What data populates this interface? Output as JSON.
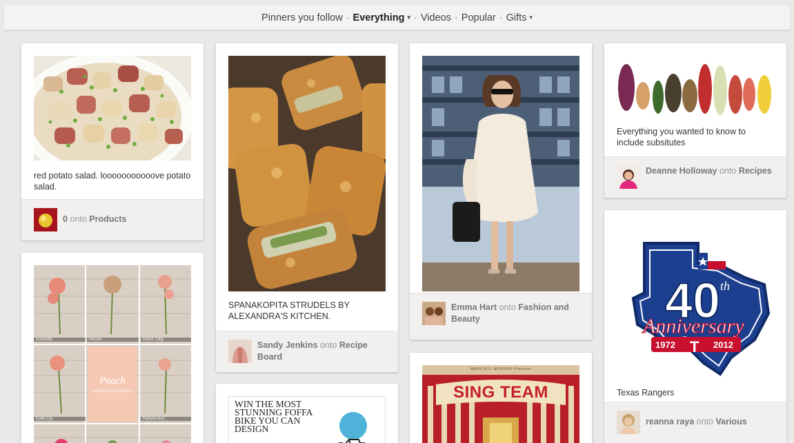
{
  "nav": {
    "items": [
      {
        "label": "Pinners you follow"
      },
      {
        "label": "Everything"
      },
      {
        "label": "Videos"
      },
      {
        "label": "Popular"
      },
      {
        "label": "Gifts"
      }
    ],
    "separator": "·",
    "caret": "▾"
  },
  "pins": {
    "potato": {
      "description": "red potato salad. looooooooooove potato salad.",
      "pinner": "0",
      "onto": "onto",
      "board": "Products"
    },
    "flowers": {
      "labels": [
        "Amaryllis",
        "Peonie",
        "Dutch Tulip",
        "Calla Lily",
        "Peach",
        "Ranunculus"
      ],
      "center_title": "Peach",
      "center_sub": "WEDDING FLOWERS"
    },
    "strudel": {
      "description": "SPANAKOPITA STRUDELS BY ALEXANDRA'S KITCHEN.",
      "pinner": "Sandy Jenkins",
      "onto": "onto",
      "board": "Recipe Board"
    },
    "win": {
      "headline": "WIN THE MOST STUNNING FOFFA BIKE YOU CAN DESIGN"
    },
    "fashion": {
      "pinner": "Emma Hart",
      "onto": "onto",
      "board": "Fashion and Beauty"
    },
    "singteam": {
      "kicker": "MARS HILL WORSHIP Presents",
      "title": "SING TEAM"
    },
    "veggies": {
      "description": "Everything you wanted to know to include subsitutes",
      "pinner": "Deanne Holloway",
      "onto": "onto",
      "board": "Recipes"
    },
    "rangers": {
      "description": "Texas Rangers",
      "pinner": "reanna raya",
      "onto": "onto",
      "board": "Various",
      "logo_text": "40th Anniversary 1972 2012"
    }
  },
  "colors": {
    "background": "#ebe9e7",
    "rangers_blue": "#1c3f8f",
    "rangers_red": "#c8102e"
  }
}
